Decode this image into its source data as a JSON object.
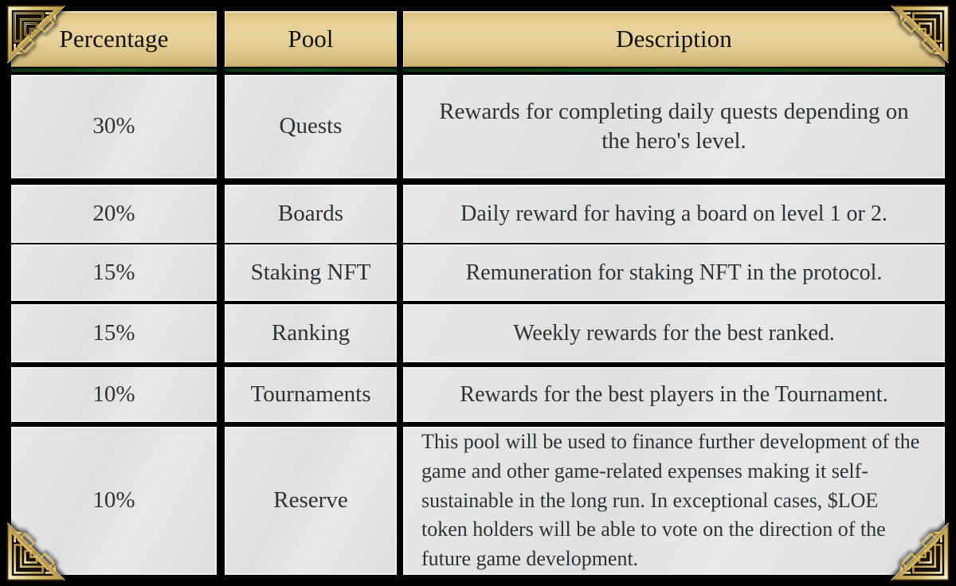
{
  "table": {
    "headers": [
      {
        "label": "Percentage"
      },
      {
        "label": "Pool"
      },
      {
        "label": "Description"
      }
    ],
    "rows": [
      {
        "percentage": "30%",
        "pool": "Quests",
        "description": "Rewards for completing daily quests depending on the hero's level."
      },
      {
        "percentage": "20%",
        "pool": "Boards",
        "description": "Daily reward for having a board on level 1 or 2."
      },
      {
        "percentage": "15%",
        "pool": "Staking NFT",
        "description": "Remuneration for staking NFT in the protocol."
      },
      {
        "percentage": "15%",
        "pool": "Ranking",
        "description": "Weekly rewards for the best ranked."
      },
      {
        "percentage": "10%",
        "pool": "Tournaments",
        "description": "Rewards for the best players in the Tournament."
      },
      {
        "percentage": "10%",
        "pool": "Reserve",
        "description": "This pool will be used to finance further development of the game and other game-related expenses making it self-sustainable in the long run. In exceptional cases, $LOE token holders will be able to vote on the direction of the future game development."
      }
    ]
  },
  "ornaments": {
    "top_left": "celtic-knot-corner-icon",
    "top_right": "celtic-knot-corner-icon",
    "bottom_left": "celtic-knot-corner-icon",
    "bottom_right": "celtic-knot-corner-icon"
  },
  "colors": {
    "background": "#000000",
    "header_gold": "#e2cb90",
    "header_gold_dark": "#cdb072",
    "cell_gray": "#e3e4e5",
    "text_dark": "#2f3234",
    "ornament_gold": "#d4b96a",
    "accent_green": "#0c5618"
  }
}
